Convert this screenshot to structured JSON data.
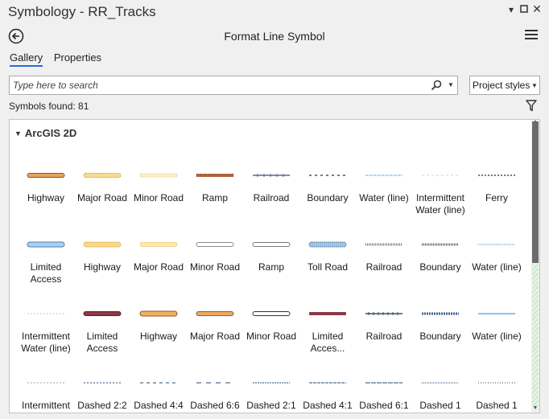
{
  "window": {
    "title": "Symbology - RR_Tracks"
  },
  "header": {
    "title": "Format Line Symbol"
  },
  "tabs": [
    {
      "label": "Gallery",
      "active": true
    },
    {
      "label": "Properties",
      "active": false
    }
  ],
  "search": {
    "placeholder": "Type here to search",
    "value": ""
  },
  "styles_dropdown": {
    "selected": "Project styles"
  },
  "results": {
    "count_text": "Symbols found: 81"
  },
  "group": {
    "label": "ArcGIS 2D"
  },
  "symbols": [
    {
      "label": "Highway",
      "style": "highway"
    },
    {
      "label": "Major Road",
      "style": "major-road"
    },
    {
      "label": "Minor Road",
      "style": "minor-road-dotted"
    },
    {
      "label": "Ramp",
      "style": "ramp-hatched"
    },
    {
      "label": "Railroad",
      "style": "railroad"
    },
    {
      "label": "Boundary",
      "style": "boundary-dashed"
    },
    {
      "label": "Water (line)",
      "style": "water"
    },
    {
      "label": "Intermittent Water (line)",
      "style": "intermittent-water"
    },
    {
      "label": "Ferry",
      "style": "ferry"
    },
    {
      "label": "Limited Access",
      "style": "limited-access-blue"
    },
    {
      "label": "Highway",
      "style": "highway-yellow"
    },
    {
      "label": "Major Road",
      "style": "major-road-yellow"
    },
    {
      "label": "Minor Road",
      "style": "minor-road-outline"
    },
    {
      "label": "Ramp",
      "style": "ramp-outline"
    },
    {
      "label": "Toll Road",
      "style": "toll-road"
    },
    {
      "label": "Railroad",
      "style": "railroad-gray"
    },
    {
      "label": "Boundary",
      "style": "boundary-dark"
    },
    {
      "label": "Water (line)",
      "style": "water-dotted"
    },
    {
      "label": "Intermittent Water (line)",
      "style": "intermittent-water-2"
    },
    {
      "label": "Limited Access",
      "style": "limited-access-maroon"
    },
    {
      "label": "Highway",
      "style": "highway-orange"
    },
    {
      "label": "Major Road",
      "style": "major-road-orange"
    },
    {
      "label": "Minor Road",
      "style": "minor-road-white"
    },
    {
      "label": "Limited Acces...",
      "style": "limited-access-thin"
    },
    {
      "label": "Railroad",
      "style": "railroad-dark"
    },
    {
      "label": "Boundary",
      "style": "boundary-blue"
    },
    {
      "label": "Water (line)",
      "style": "water-blue"
    },
    {
      "label": "Intermittent",
      "style": "dashed-light"
    },
    {
      "label": "Dashed 2:2",
      "style": "dash-22"
    },
    {
      "label": "Dashed 4:4",
      "style": "dash-44"
    },
    {
      "label": "Dashed 6:6",
      "style": "dash-66"
    },
    {
      "label": "Dashed 2:1",
      "style": "dash-21"
    },
    {
      "label": "Dashed 4:1",
      "style": "dash-41"
    },
    {
      "label": "Dashed 6:1",
      "style": "dash-61"
    },
    {
      "label": "Dashed 1",
      "style": "dash-1"
    },
    {
      "label": "Dashed 1",
      "style": "dash-1b"
    }
  ],
  "colors": {
    "accent": "#2a6bd6",
    "scroll_thumb": "#6b6b6b"
  },
  "icons": [
    "back-icon",
    "menu-icon",
    "search-icon",
    "filter-icon",
    "chevron-down-icon"
  ]
}
